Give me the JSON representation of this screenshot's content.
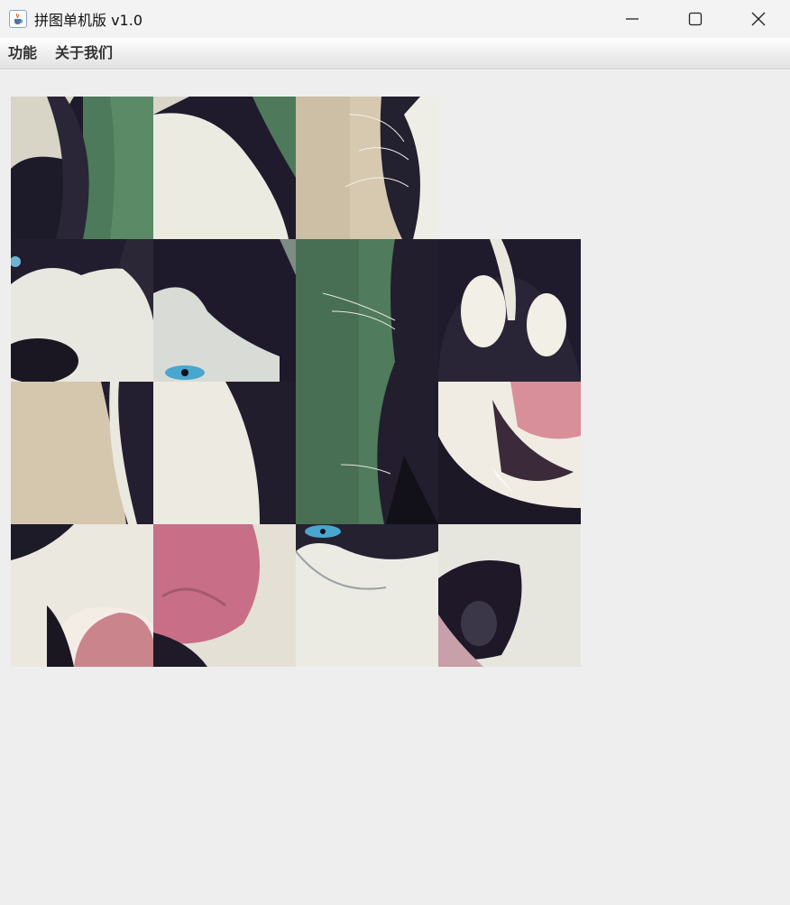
{
  "window": {
    "title": "拼图单机版 v1.0",
    "icon": "java-cup-icon",
    "controls": [
      "minimize-icon",
      "maximize-icon",
      "close-icon"
    ]
  },
  "menu": {
    "items": [
      {
        "label": "功能"
      },
      {
        "label": "关于我们"
      }
    ]
  },
  "puzzle": {
    "grid_size": 4,
    "empty_tile": {
      "row": 0,
      "col": 3
    },
    "tiles": [
      {
        "row": 0,
        "col": 0,
        "content": "husky-ear-and-fur"
      },
      {
        "row": 0,
        "col": 1,
        "content": "husky-white-fur-patch"
      },
      {
        "row": 0,
        "col": 2,
        "content": "husky-whiskers-edge"
      },
      {
        "row": 1,
        "col": 0,
        "content": "husky-nose-and-eye"
      },
      {
        "row": 1,
        "col": 1,
        "content": "husky-blue-eye"
      },
      {
        "row": 1,
        "col": 2,
        "content": "blurred-background-whiskers"
      },
      {
        "row": 1,
        "col": 3,
        "content": "husky-forehead"
      },
      {
        "row": 2,
        "col": 0,
        "content": "blurred-beige-background"
      },
      {
        "row": 2,
        "col": 1,
        "content": "husky-cheek-fur"
      },
      {
        "row": 2,
        "col": 2,
        "content": "husky-muzzle-profile"
      },
      {
        "row": 2,
        "col": 3,
        "content": "husky-open-mouth-teeth"
      },
      {
        "row": 3,
        "col": 0,
        "content": "husky-chin-and-tongue"
      },
      {
        "row": 3,
        "col": 1,
        "content": "husky-pink-tongue"
      },
      {
        "row": 3,
        "col": 2,
        "content": "husky-eye-and-white-face"
      },
      {
        "row": 3,
        "col": 3,
        "content": "husky-mouth-corner"
      }
    ]
  },
  "colors": {
    "fur_dark": "#1e1a2c",
    "fur_white": "#eeeee6",
    "background_green": "#4f7c5c",
    "background_beige": "#d5c8b0",
    "tongue_pink": "#c86e86",
    "eye_blue": "#49a7cf"
  }
}
